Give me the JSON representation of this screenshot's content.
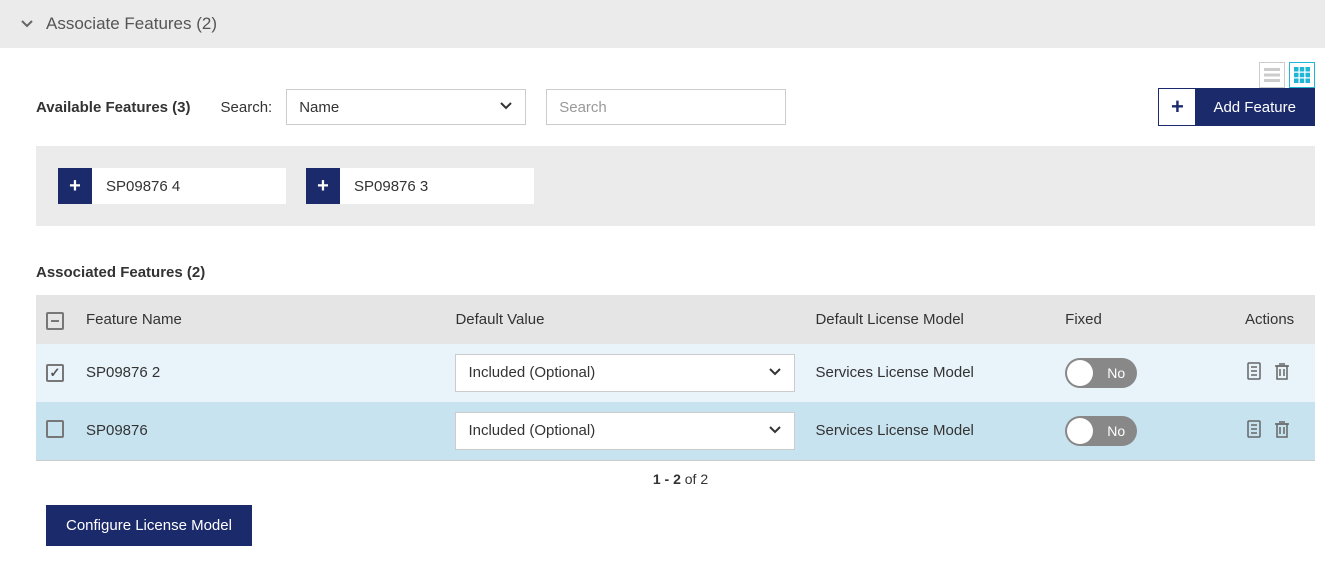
{
  "header": {
    "title": "Associate Features (2)"
  },
  "available": {
    "label": "Available Features (3)",
    "search_label": "Search:",
    "search_field": "Name",
    "search_placeholder": "Search",
    "add_feature_label": "Add Feature",
    "chips": [
      {
        "label": "SP09876 4"
      },
      {
        "label": "SP09876 3"
      }
    ]
  },
  "associated": {
    "label": "Associated Features (2)",
    "columns": {
      "name": "Feature Name",
      "default_value": "Default Value",
      "default_license_model": "Default License Model",
      "fixed": "Fixed",
      "actions": "Actions"
    },
    "rows": [
      {
        "checked": true,
        "name": "SP09876 2",
        "default_value": "Included (Optional)",
        "license_model": "Services License Model",
        "fixed": "No"
      },
      {
        "checked": false,
        "name": "SP09876",
        "default_value": "Included (Optional)",
        "license_model": "Services License Model",
        "fixed": "No"
      }
    ]
  },
  "pager": {
    "range": "1 - 2",
    "of": " of 2"
  },
  "buttons": {
    "configure": "Configure License Model"
  }
}
